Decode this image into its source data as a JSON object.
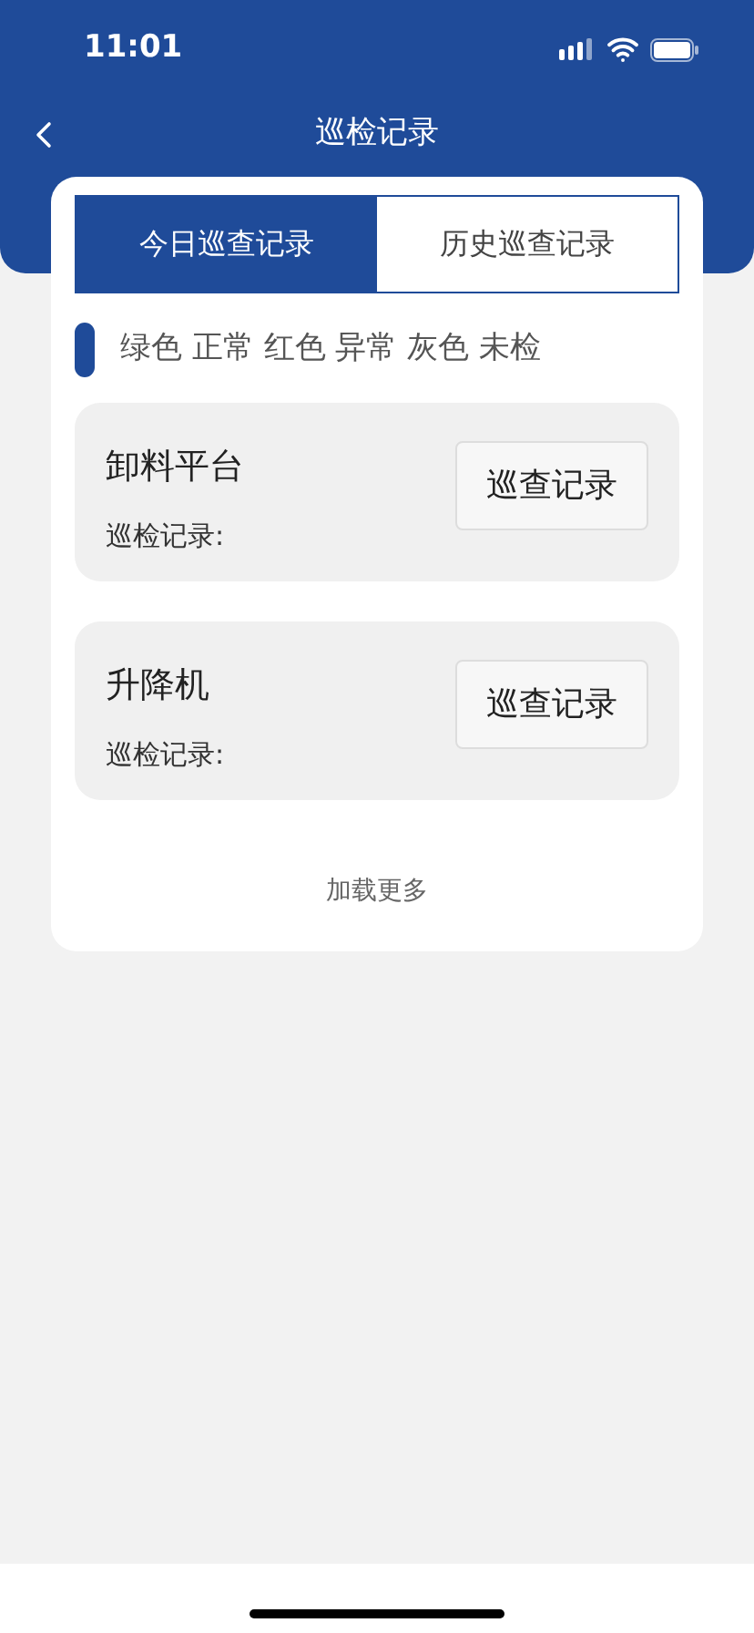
{
  "status_bar": {
    "time": "11:01"
  },
  "nav": {
    "title": "巡检记录"
  },
  "tabs": [
    {
      "label": "今日巡查记录",
      "selected": true
    },
    {
      "label": "历史巡查记录",
      "selected": false
    }
  ],
  "legend": "绿色 正常 红色 异常 灰色 未检",
  "records": [
    {
      "name": "卸料平台",
      "note": "巡检记录:",
      "button": "巡查记录"
    },
    {
      "name": "升降机",
      "note": "巡检记录:",
      "button": "巡查记录"
    }
  ],
  "load_more": "加载更多"
}
